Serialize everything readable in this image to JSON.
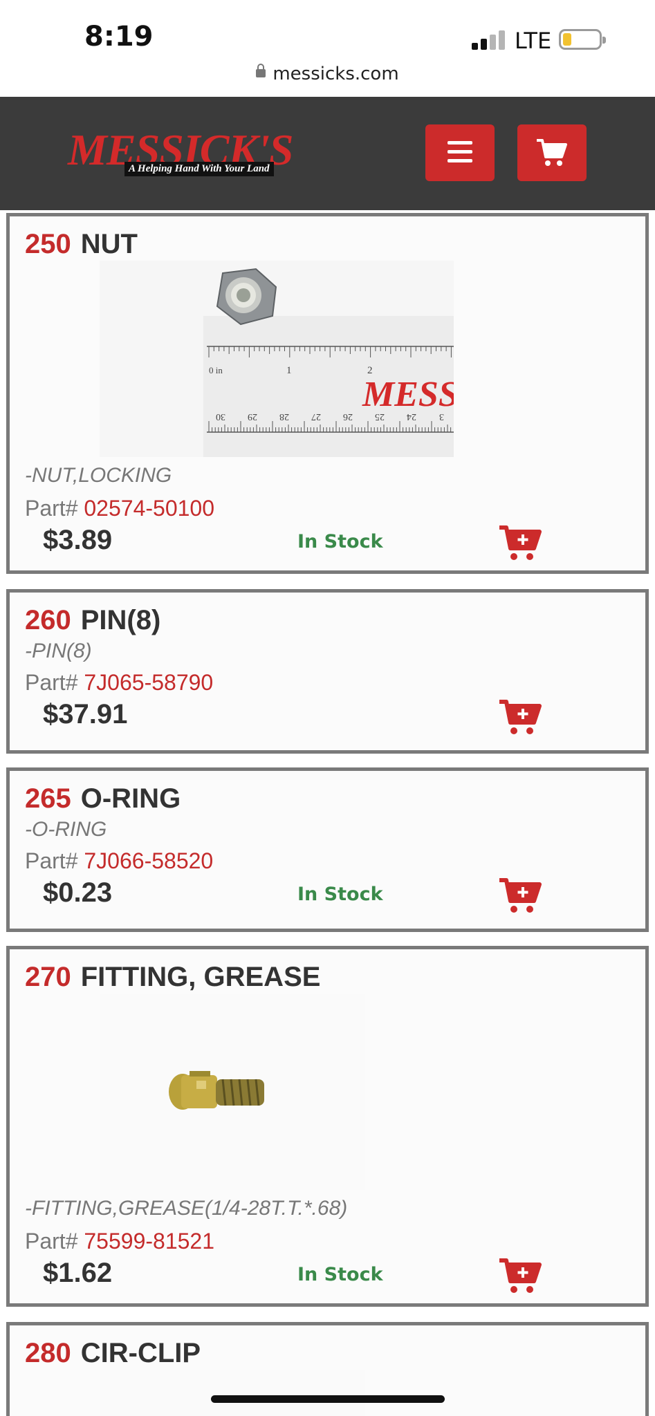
{
  "status_bar": {
    "time": "8:19",
    "network": "LTE",
    "url": "messicks.com"
  },
  "header": {
    "logo_text": "MESSICK'S",
    "logo_tagline": "A Helping Hand With Your Land",
    "menu_icon": "hamburger-icon",
    "cart_icon": "cart-icon"
  },
  "colors": {
    "brand_red": "#cc2b2b",
    "header_bg": "#3b3b3b",
    "in_stock_green": "#3a8a4a",
    "card_border": "#7a7a7a"
  },
  "labels": {
    "part_prefix": "Part#"
  },
  "parts": [
    {
      "ref": "250",
      "name": "NUT",
      "description": "-NUT,LOCKING",
      "part_number": "02574-50100",
      "price": "$3.89",
      "stock": "In Stock",
      "image": "locking-nut-with-ruler"
    },
    {
      "ref": "260",
      "name": "PIN(8)",
      "description": "-PIN(8)",
      "part_number": "7J065-58790",
      "price": "$37.91",
      "stock": ""
    },
    {
      "ref": "265",
      "name": "O-RING",
      "description": "-O-RING",
      "part_number": "7J066-58520",
      "price": "$0.23",
      "stock": "In Stock"
    },
    {
      "ref": "270",
      "name": "FITTING, GREASE",
      "description": "-FITTING,GREASE(1/4-28T.T.*.68)",
      "part_number": "75599-81521",
      "price": "$1.62",
      "stock": "In Stock",
      "image": "grease-fitting"
    },
    {
      "ref": "280",
      "name": "CIR-CLIP"
    }
  ]
}
